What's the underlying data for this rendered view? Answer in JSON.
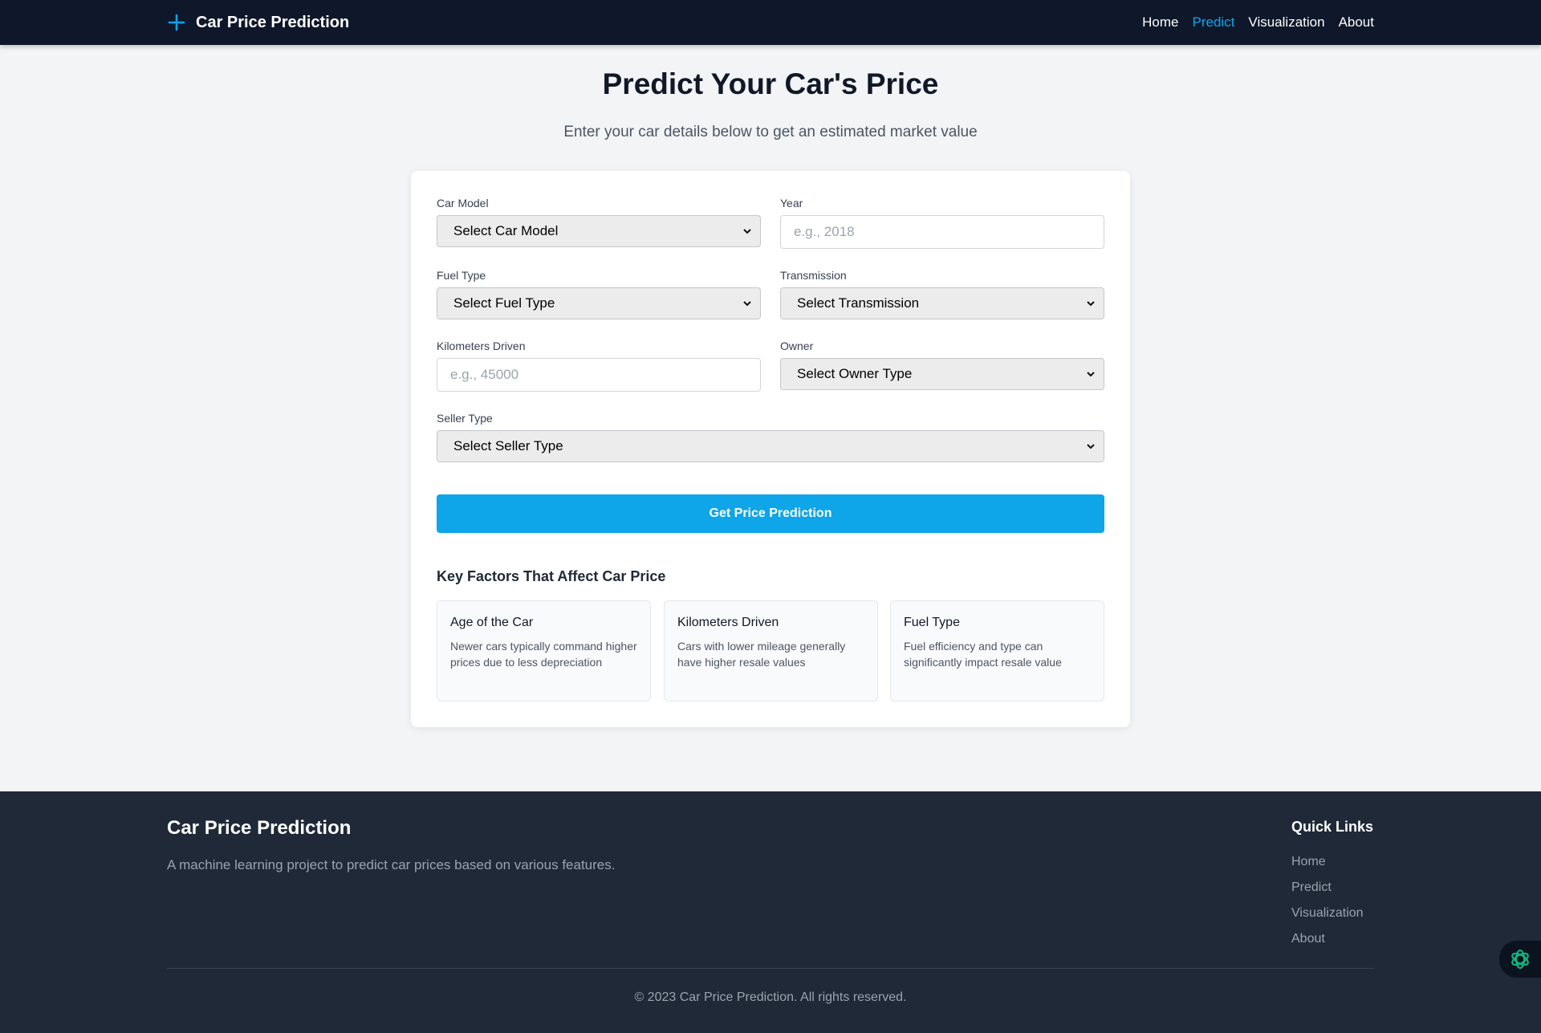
{
  "navbar": {
    "brand": "Car Price Prediction",
    "links": [
      {
        "label": "Home"
      },
      {
        "label": "Predict"
      },
      {
        "label": "Visualization"
      },
      {
        "label": "About"
      }
    ]
  },
  "hero": {
    "title": "Predict Your Car's Price",
    "subtitle": "Enter your car details below to get an estimated market value"
  },
  "form": {
    "car_model": {
      "label": "Car Model",
      "value": "Select Car Model"
    },
    "year": {
      "label": "Year",
      "placeholder": "e.g., 2018"
    },
    "fuel_type": {
      "label": "Fuel Type",
      "value": "Select Fuel Type"
    },
    "transmission": {
      "label": "Transmission",
      "value": "Select Transmission"
    },
    "kilometers": {
      "label": "Kilometers Driven",
      "placeholder": "e.g., 45000"
    },
    "owner": {
      "label": "Owner",
      "value": "Select Owner Type"
    },
    "seller_type": {
      "label": "Seller Type",
      "value": "Select Seller Type"
    },
    "submit_label": "Get Price Prediction"
  },
  "factors": {
    "title": "Key Factors That Affect Car Price",
    "items": [
      {
        "title": "Age of the Car",
        "desc": "Newer cars typically command higher prices due to less depreciation"
      },
      {
        "title": "Kilometers Driven",
        "desc": "Cars with lower mileage generally have higher resale values"
      },
      {
        "title": "Fuel Type",
        "desc": "Fuel efficiency and type can significantly impact resale value"
      }
    ]
  },
  "footer": {
    "title": "Car Price Prediction",
    "description": "A machine learning project to predict car prices based on various features.",
    "quick_links_title": "Quick Links",
    "quick_links": [
      "Home",
      "Predict",
      "Visualization",
      "About"
    ],
    "copyright": "© 2023 Car Price Prediction. All rights reserved."
  },
  "colors": {
    "navbar_bg": "#0f172a",
    "accent": "#0ea5e9",
    "footer_bg": "#1f2937",
    "page_bg": "#f3f4f6"
  },
  "icons": {
    "brand": "plus-icon",
    "select_arrow": "chevron-down-icon",
    "floating": "openai-logo-icon"
  }
}
